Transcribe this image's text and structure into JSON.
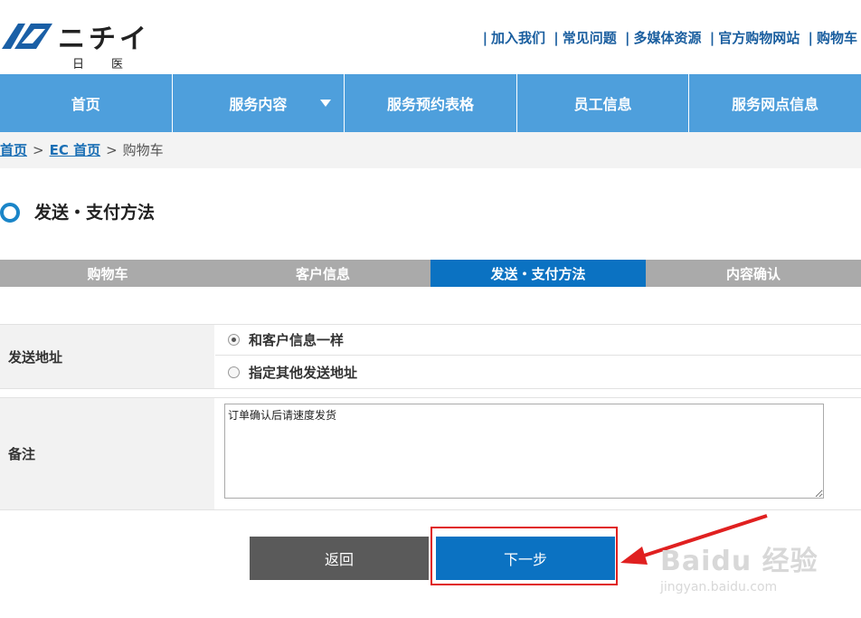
{
  "header": {
    "logo_text": "ニチイ",
    "logo_sub": "日医",
    "links": [
      "加入我们",
      "常见问题",
      "多媒体资源",
      "官方购物网站",
      "购物车"
    ],
    "separator": "|"
  },
  "nav": {
    "items": [
      "首页",
      "服务内容",
      "服务预约表格",
      "员工信息",
      "服务网点信息"
    ]
  },
  "breadcrumb": {
    "items": [
      "首页",
      "EC 首页",
      "购物车"
    ],
    "separator": ">"
  },
  "section": {
    "title": "发送・支付方法"
  },
  "steps": {
    "items": [
      "购物车",
      "客户信息",
      "发送・支付方法",
      "内容确认"
    ],
    "active_index": 2
  },
  "form": {
    "address_label": "发送地址",
    "address_options": [
      "和客户信息一样",
      "指定其他发送地址"
    ],
    "address_selected_index": 0,
    "remark_label": "备注",
    "remark_value": "订单确认后请速度发货"
  },
  "buttons": {
    "back": "返回",
    "next": "下一步"
  },
  "watermark": {
    "main": "Baidu 经验",
    "sub": "jingyan.baidu.com"
  },
  "colors": {
    "nav_bg": "#4e9fdc",
    "accent": "#0b72c2",
    "step_inactive": "#aaaaaa",
    "highlight": "#e02020"
  }
}
